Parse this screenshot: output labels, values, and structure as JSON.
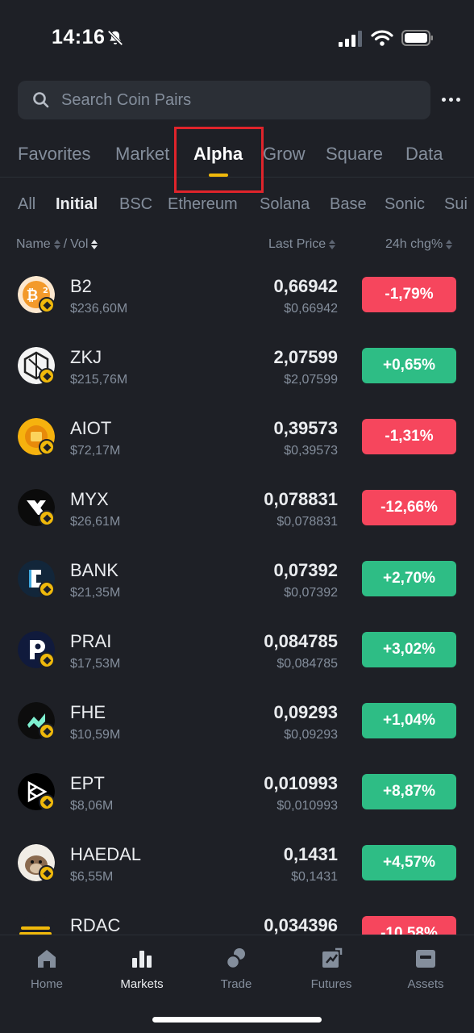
{
  "status_bar": {
    "time": "14:16"
  },
  "search": {
    "placeholder": "Search Coin Pairs"
  },
  "main_tabs": [
    {
      "label": "Favorites"
    },
    {
      "label": "Market"
    },
    {
      "label": "Alpha",
      "active": true
    },
    {
      "label": "Grow"
    },
    {
      "label": "Square"
    },
    {
      "label": "Data"
    }
  ],
  "sub_tabs": [
    {
      "label": "All"
    },
    {
      "label": "Initial",
      "active": true
    },
    {
      "label": "BSC"
    },
    {
      "label": "Ethereum"
    },
    {
      "label": "Solana"
    },
    {
      "label": "Base"
    },
    {
      "label": "Sonic"
    },
    {
      "label": "Sui"
    }
  ],
  "table_header": {
    "name": "Name",
    "separator": "/",
    "vol": "Vol",
    "last_price": "Last Price",
    "change": "24h chg%"
  },
  "coins": [
    {
      "symbol": "B2",
      "volume": "$236,60M",
      "price": "0,66942",
      "price_usd": "$0,66942",
      "change": "-1,79%",
      "direction": "down",
      "icon": "b2-coin-icon"
    },
    {
      "symbol": "ZKJ",
      "volume": "$215,76M",
      "price": "2,07599",
      "price_usd": "$2,07599",
      "change": "+0,65%",
      "direction": "up",
      "icon": "zkj-coin-icon"
    },
    {
      "symbol": "AIOT",
      "volume": "$72,17M",
      "price": "0,39573",
      "price_usd": "$0,39573",
      "change": "-1,31%",
      "direction": "down",
      "icon": "aiot-coin-icon"
    },
    {
      "symbol": "MYX",
      "volume": "$26,61M",
      "price": "0,078831",
      "price_usd": "$0,078831",
      "change": "-12,66%",
      "direction": "down",
      "icon": "myx-coin-icon"
    },
    {
      "symbol": "BANK",
      "volume": "$21,35M",
      "price": "0,07392",
      "price_usd": "$0,07392",
      "change": "+2,70%",
      "direction": "up",
      "icon": "bank-coin-icon"
    },
    {
      "symbol": "PRAI",
      "volume": "$17,53M",
      "price": "0,084785",
      "price_usd": "$0,084785",
      "change": "+3,02%",
      "direction": "up",
      "icon": "prai-coin-icon"
    },
    {
      "symbol": "FHE",
      "volume": "$10,59M",
      "price": "0,09293",
      "price_usd": "$0,09293",
      "change": "+1,04%",
      "direction": "up",
      "icon": "fhe-coin-icon"
    },
    {
      "symbol": "EPT",
      "volume": "$8,06M",
      "price": "0,010993",
      "price_usd": "$0,010993",
      "change": "+8,87%",
      "direction": "up",
      "icon": "ept-coin-icon"
    },
    {
      "symbol": "HAEDAL",
      "volume": "$6,55M",
      "price": "0,1431",
      "price_usd": "$0,1431",
      "change": "+4,57%",
      "direction": "up",
      "icon": "haedal-coin-icon"
    },
    {
      "symbol": "RDAC",
      "volume": "",
      "price": "0,034396",
      "price_usd": "",
      "change": "-10,58%",
      "direction": "down",
      "icon": "rdac-coin-icon"
    }
  ],
  "bottom_nav": [
    {
      "label": "Home",
      "icon": "home-icon"
    },
    {
      "label": "Markets",
      "icon": "markets-icon",
      "active": true
    },
    {
      "label": "Trade",
      "icon": "trade-icon"
    },
    {
      "label": "Futures",
      "icon": "futures-icon"
    },
    {
      "label": "Assets",
      "icon": "assets-icon"
    }
  ],
  "colors": {
    "background": "#1e2026",
    "accent": "#f0b90b",
    "up": "#2ebd85",
    "down": "#f6465d",
    "highlight": "#e0242b"
  }
}
